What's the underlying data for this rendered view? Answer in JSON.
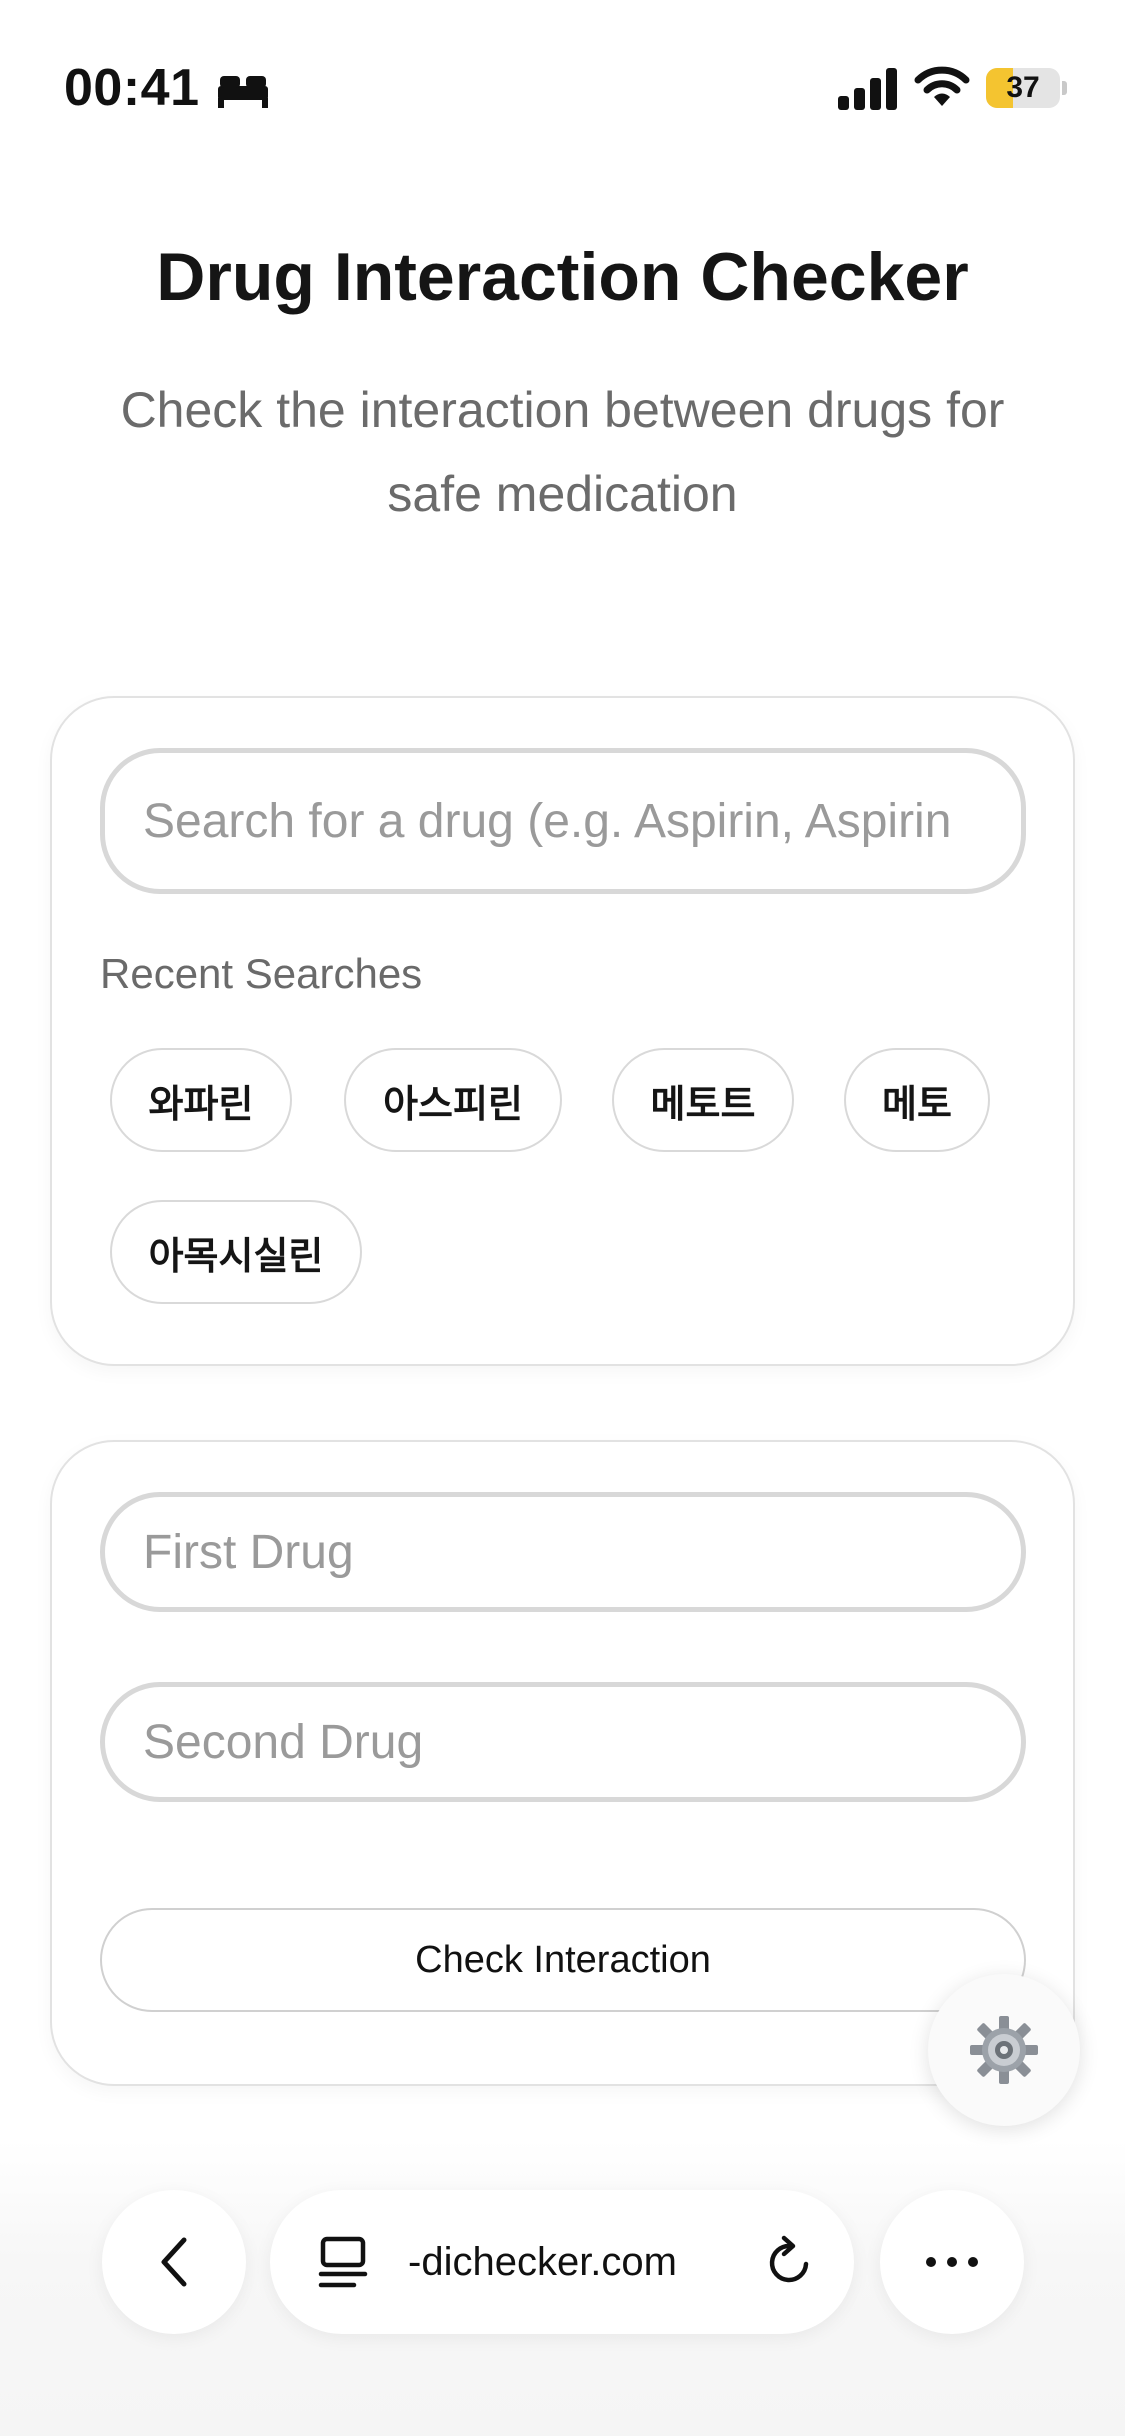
{
  "status": {
    "time": "00:41",
    "battery_percent": 37,
    "battery_text": "37",
    "icons": [
      "bed-icon",
      "signal-icon",
      "wifi-icon",
      "battery-icon"
    ]
  },
  "header": {
    "title": "Drug Interaction Checker",
    "subtitle": "Check the interaction between drugs for safe medication"
  },
  "search": {
    "placeholder": "Search for a drug (e.g. Aspirin, Aspirin",
    "recent_label": "Recent Searches",
    "recent": [
      "와파린",
      "아스피린",
      "메토트",
      "메토",
      "아목시실린"
    ]
  },
  "checker": {
    "first_placeholder": "First Drug",
    "second_placeholder": "Second Drug",
    "button_label": "Check Interaction"
  },
  "fab": {
    "icon": "gear-icon"
  },
  "browser": {
    "url": "-dichecker.com",
    "icons": [
      "back-chevron-icon",
      "tab-overview-icon",
      "reload-icon",
      "more-icon"
    ]
  },
  "colors": {
    "battery_fill": "#f4c430",
    "border": "#d8d8d8",
    "muted_text": "#6b6b6b",
    "placeholder_text": "#9a9a9a"
  }
}
